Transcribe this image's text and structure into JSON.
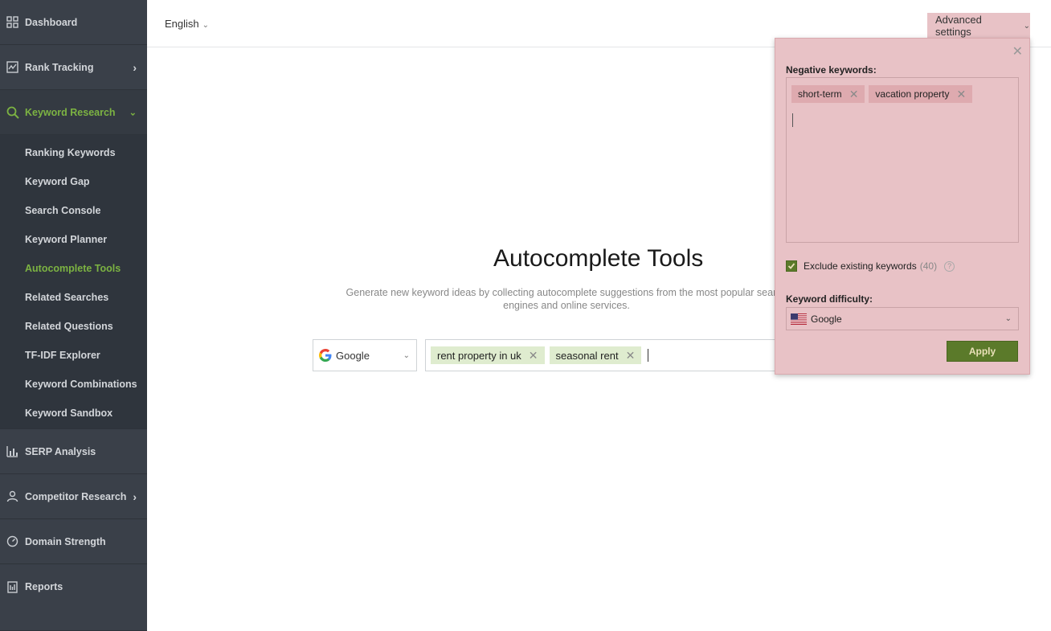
{
  "sidebar": {
    "items": [
      {
        "label": "Dashboard",
        "icon": "grid-icon"
      },
      {
        "label": "Rank Tracking",
        "icon": "line-chart-icon"
      },
      {
        "label": "Keyword Research",
        "icon": "search-icon",
        "expanded": true
      },
      {
        "label": "SERP Analysis",
        "icon": "bar-chart-icon"
      },
      {
        "label": "Competitor Research",
        "icon": "person-icon"
      },
      {
        "label": "Domain Strength",
        "icon": "gauge-icon"
      },
      {
        "label": "Reports",
        "icon": "report-icon"
      }
    ],
    "submenu": [
      {
        "label": "Ranking Keywords"
      },
      {
        "label": "Keyword Gap"
      },
      {
        "label": "Search Console"
      },
      {
        "label": "Keyword Planner"
      },
      {
        "label": "Autocomplete Tools",
        "active": true
      },
      {
        "label": "Related Searches"
      },
      {
        "label": "Related Questions"
      },
      {
        "label": "TF-IDF Explorer"
      },
      {
        "label": "Keyword Combinations"
      },
      {
        "label": "Keyword Sandbox"
      }
    ]
  },
  "topbar": {
    "language": "English",
    "advanced_settings": "Advanced settings"
  },
  "main": {
    "title": "Autocomplete Tools",
    "description": "Generate new keyword ideas by collecting autocomplete suggestions from the most popular search engines and online services.",
    "engine": "Google",
    "keywords": [
      "rent property in uk",
      "seasonal rent"
    ]
  },
  "panel": {
    "negative_label": "Negative keywords:",
    "negative_keywords": [
      "short-term",
      "vacation property"
    ],
    "exclude_label": "Exclude existing keywords",
    "exclude_count": "(40)",
    "exclude_checked": true,
    "help": "?",
    "difficulty_label": "Keyword difficulty:",
    "difficulty_value": "Google",
    "apply": "Apply"
  },
  "colors": {
    "sidebar_bg": "#3a4049",
    "accent_green": "#7cb342",
    "panel_bg": "#e8c2c6",
    "apply_bg": "#5b7a2a",
    "tag_green": "#dfeccf"
  }
}
